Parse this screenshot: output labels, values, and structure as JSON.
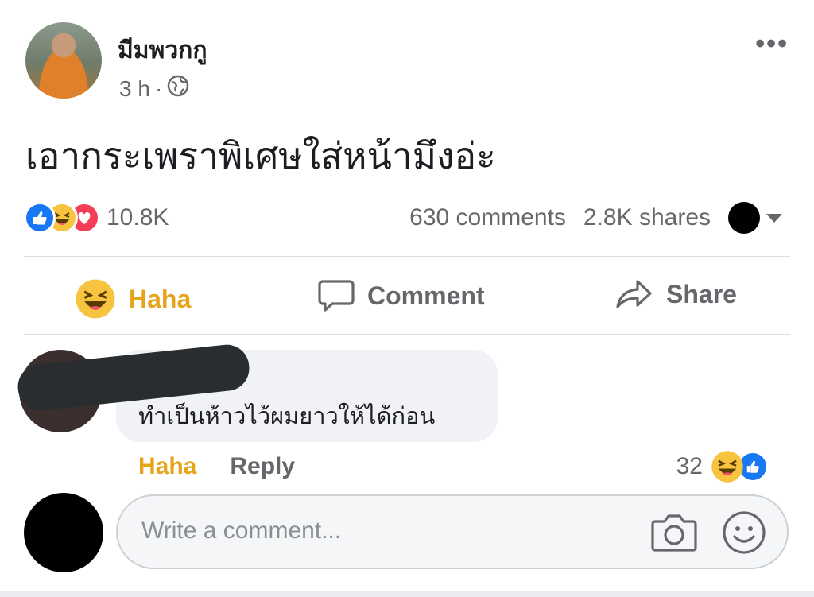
{
  "post": {
    "author": "มีมพวกกู",
    "time": "3 h",
    "separator": "·",
    "more_label": "•••",
    "text": "เอากระเพราพิเศษใส่หน้ามึงอ่ะ"
  },
  "stats": {
    "reaction_count": "10.8K",
    "comments": "630 comments",
    "shares": "2.8K shares",
    "reaction_icons": [
      "like-icon",
      "haha-icon",
      "love-icon"
    ]
  },
  "actions": {
    "haha_label": "Haha",
    "comment_label": "Comment",
    "share_label": "Share"
  },
  "comment": {
    "text": "ทำเป็นห้าวไว้ผมยาวให้ได้ก่อน",
    "haha_label": "Haha",
    "reply_label": "Reply",
    "reaction_count": "32"
  },
  "composer": {
    "placeholder": "Write a comment..."
  },
  "colors": {
    "haha_accent": "#e5a41a",
    "like_blue": "#1877f2",
    "love_red": "#f33e58",
    "muted_text": "#65676b"
  }
}
